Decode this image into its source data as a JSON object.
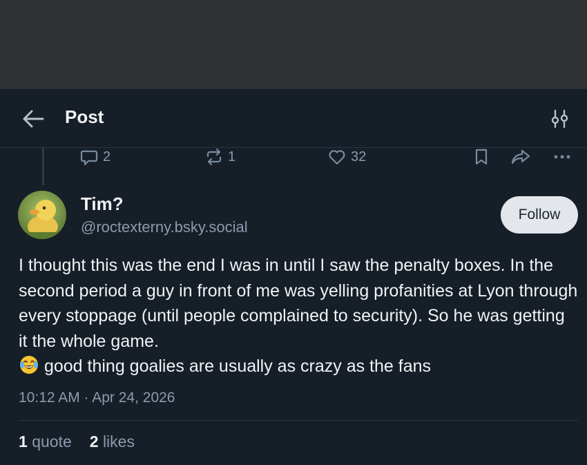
{
  "header": {
    "title": "Post",
    "back_icon": "arrow-left-icon",
    "filter_icon": "sliders-icon"
  },
  "parent_actions": {
    "reply_count": "2",
    "repost_count": "1",
    "like_count": "32"
  },
  "post": {
    "author_name": "Tim?",
    "author_handle": "@roctexterny.bsky.social",
    "follow_label": "Follow",
    "text_before_emoji": "I thought this was the end I was in until I saw the penalty boxes. In the second period a guy in front of me was yelling profanities at Lyon through every stoppage (until people complained to security). So he was getting it the whole game.",
    "text_after_emoji": "good thing goalies are usually as crazy as the fans",
    "timestamp": "10:12 AM · Apr 24, 2026",
    "quotes_count": "1",
    "quotes_label": "quote",
    "likes_count": "2",
    "likes_label": "likes"
  },
  "colors": {
    "background": "#161e27",
    "top_band": "#313236",
    "muted_text": "#8d9bad",
    "primary_text": "#f1f3f5",
    "follow_button": "#e3e7ec"
  }
}
